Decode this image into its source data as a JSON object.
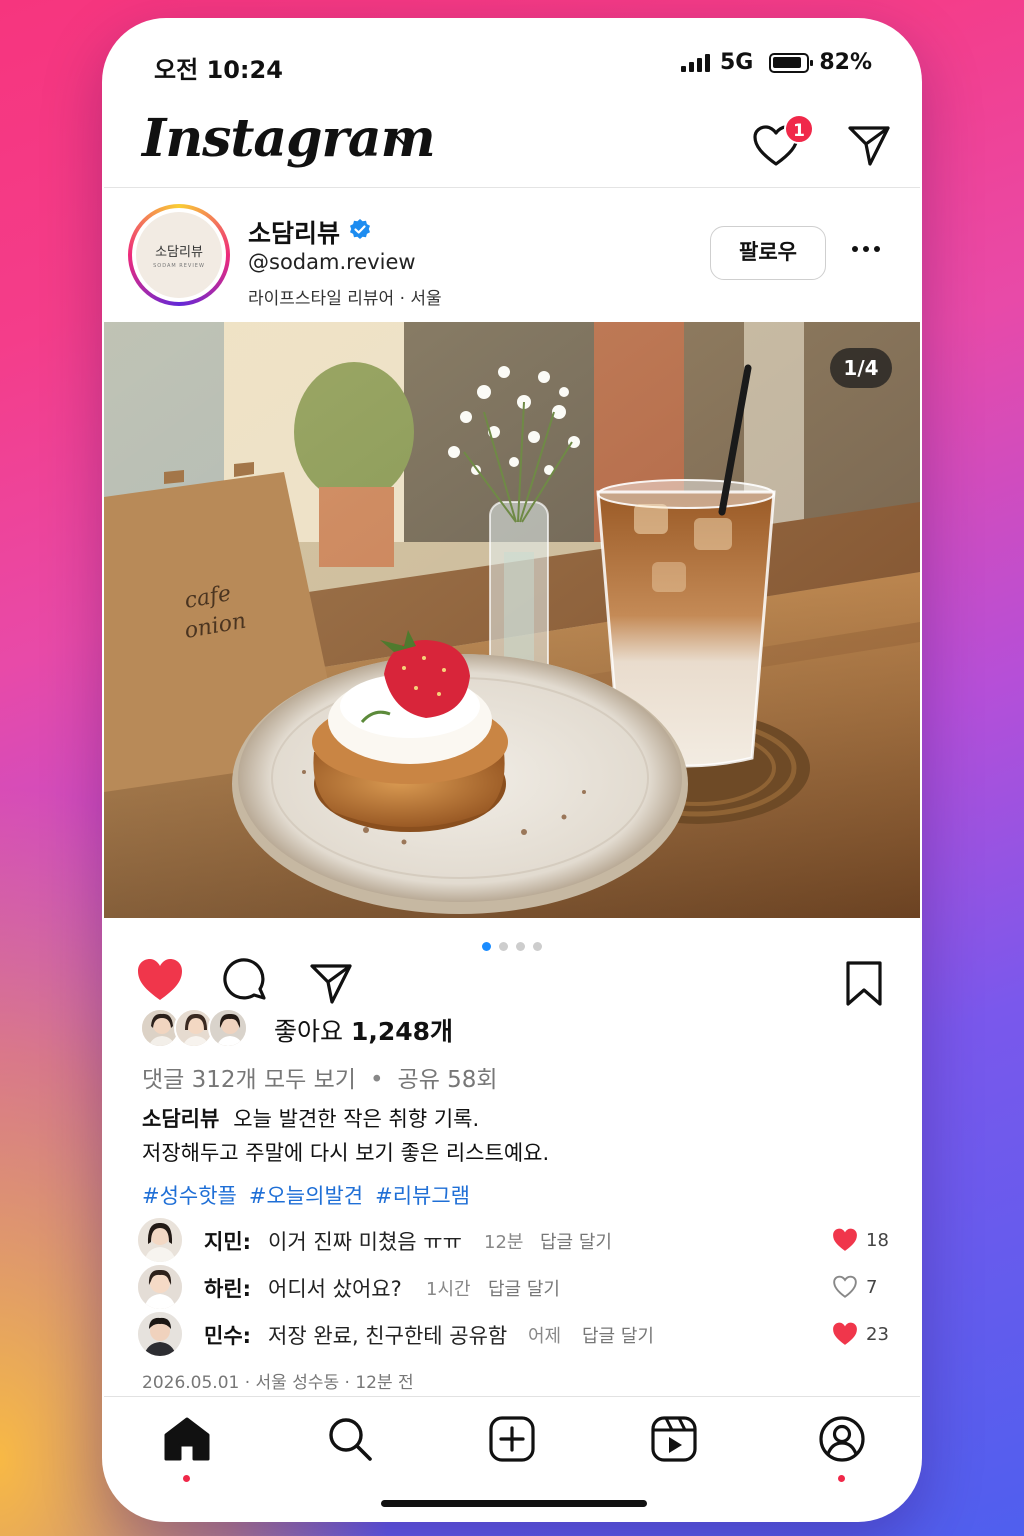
{
  "status_bar": {
    "time": "오전 10:24",
    "network": "5G",
    "battery": "82%"
  },
  "header": {
    "logo": "Instagram",
    "notification_count": "1",
    "icons": [
      "chevron-down-icon",
      "heart-icon",
      "send-icon"
    ]
  },
  "profile": {
    "avatar_text": "소담리뷰",
    "avatar_subtext": "SODAM REVIEW",
    "name": "소담리뷰",
    "handle": "@sodam.review",
    "bio": "라이프스타일 리뷰어 · 서울",
    "follow_label": "팔로우"
  },
  "post": {
    "image_sign": [
      "cafe",
      "onion"
    ],
    "slide_indicator": "1/4",
    "slide_count": 4,
    "active_slide": 1,
    "liked": true,
    "likes_prefix": "좋아요",
    "likes_count": "1,248개",
    "comments_link": "댓글 312개 모두 보기",
    "separator": "•",
    "shares": "공유 58회",
    "caption_name": "소담리뷰",
    "caption_line1": "오늘 발견한 작은 취향 기록.",
    "caption_line2": "저장해두고 주말에 다시 보기 좋은 리스트예요.",
    "hashtags": [
      "#성수핫플",
      "#오늘의발견",
      "#리뷰그램"
    ],
    "date_line": "2026.05.01 · 서울 성수동 · 12분 전"
  },
  "comments": [
    {
      "name": "지민:",
      "text": "이거 진짜 미쳤음 ㅠㅠ",
      "time": "12분",
      "reply": "답글 달기",
      "likes": "18",
      "liked": true
    },
    {
      "name": "하린:",
      "text": "어디서 샀어요?",
      "time": "1시간",
      "reply": "답글 달기",
      "likes": "7",
      "liked": false
    },
    {
      "name": "민수:",
      "text": "저장 완료, 친구한테 공유함",
      "time": "어제",
      "reply": "답글 달기",
      "likes": "23",
      "liked": true
    }
  ],
  "bottom_nav": [
    "home-icon",
    "search-icon",
    "create-icon",
    "reels-icon",
    "profile-icon"
  ],
  "colors": {
    "accent": "#f0364b",
    "link": "#1f6fd6",
    "badge": "#f02849",
    "verified": "#1d8cf0"
  }
}
